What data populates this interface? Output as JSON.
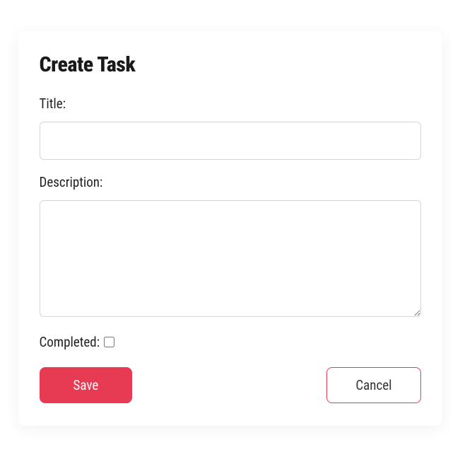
{
  "header": {
    "title": "Create Task"
  },
  "form": {
    "title": {
      "label": "Title:",
      "value": ""
    },
    "description": {
      "label": "Description:",
      "value": ""
    },
    "completed": {
      "label": "Completed:",
      "checked": false
    }
  },
  "actions": {
    "save_label": "Save",
    "cancel_label": "Cancel"
  }
}
